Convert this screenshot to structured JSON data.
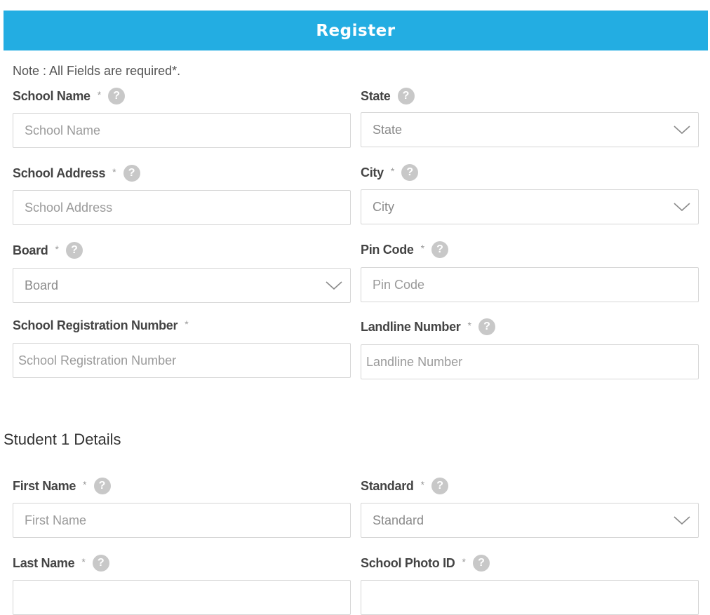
{
  "header": {
    "title": "Register"
  },
  "note": "Note : All Fields are required*.",
  "school_fields": {
    "school_name": {
      "label": "School Name",
      "required": "*",
      "placeholder": "School Name"
    },
    "state": {
      "label": "State",
      "selected": "State"
    },
    "school_address": {
      "label": "School Address",
      "required": "*",
      "placeholder": "School Address"
    },
    "city": {
      "label": "City",
      "required": "*",
      "selected": "City"
    },
    "board": {
      "label": "Board",
      "required": "*",
      "selected": "Board"
    },
    "pin_code": {
      "label": "Pin Code",
      "required": "*",
      "placeholder": "Pin Code"
    },
    "registration_number": {
      "label": "School Registration Number",
      "required": "*",
      "placeholder": "School Registration Number"
    },
    "landline_number": {
      "label": "Landline Number",
      "required": "*",
      "placeholder": "Landline Number"
    }
  },
  "student_section": {
    "title": "Student 1 Details",
    "first_name": {
      "label": "First Name",
      "required": "*",
      "placeholder": "First Name"
    },
    "standard": {
      "label": "Standard",
      "required": "*",
      "selected": "Standard"
    },
    "last_name": {
      "label": "Last Name",
      "required": "*"
    },
    "school_photo_id": {
      "label": "School Photo ID",
      "required": "*"
    }
  },
  "icons": {
    "help": "?"
  },
  "colors": {
    "header_bg": "#23ade2",
    "help_icon_bg": "#c8c8c8",
    "border": "#d6d6d6"
  }
}
